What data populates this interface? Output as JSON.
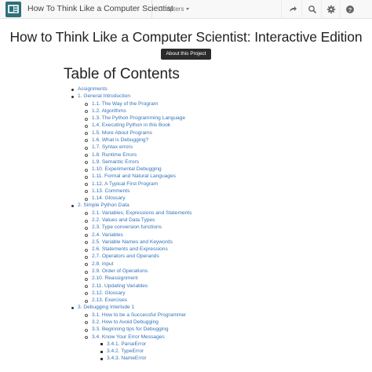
{
  "navbar": {
    "title": "How To Think Like a Computer Scientist",
    "chapters_label": "Chapters",
    "icons": [
      "forward-icon",
      "search-icon",
      "gear-icon",
      "help-icon"
    ]
  },
  "header": {
    "title": "How to Think Like a Computer Scientist: Interactive Edition",
    "about_button": "About this Project"
  },
  "toc": {
    "heading": "Table of Contents",
    "items": [
      {
        "level": 1,
        "label": "Assignments"
      },
      {
        "level": 1,
        "label": "1. General Introduction"
      },
      {
        "level": 2,
        "label": "1.1. The Way of the Program"
      },
      {
        "level": 2,
        "label": "1.2. Algorithms"
      },
      {
        "level": 2,
        "label": "1.3. The Python Programming Language"
      },
      {
        "level": 2,
        "label": "1.4. Executing Python in this Book"
      },
      {
        "level": 2,
        "label": "1.5. More About Programs"
      },
      {
        "level": 2,
        "label": "1.6. What is Debugging?"
      },
      {
        "level": 2,
        "label": "1.7. Syntax errors"
      },
      {
        "level": 2,
        "label": "1.8. Runtime Errors"
      },
      {
        "level": 2,
        "label": "1.9. Semantic Errors"
      },
      {
        "level": 2,
        "label": "1.10. Experimental Debugging"
      },
      {
        "level": 2,
        "label": "1.11. Formal and Natural Languages"
      },
      {
        "level": 2,
        "label": "1.12. A Typical First Program"
      },
      {
        "level": 2,
        "label": "1.13. Comments"
      },
      {
        "level": 2,
        "label": "1.14. Glossary"
      },
      {
        "level": 1,
        "label": "2. Simple Python Data"
      },
      {
        "level": 2,
        "label": "2.1. Variables, Expressions and Statements"
      },
      {
        "level": 2,
        "label": "2.2. Values and Data Types"
      },
      {
        "level": 2,
        "label": "2.3. Type conversion functions"
      },
      {
        "level": 2,
        "label": "2.4. Variables"
      },
      {
        "level": 2,
        "label": "2.5. Variable Names and Keywords"
      },
      {
        "level": 2,
        "label": "2.6. Statements and Expressions"
      },
      {
        "level": 2,
        "label": "2.7. Operators and Operands"
      },
      {
        "level": 2,
        "label": "2.8. Input"
      },
      {
        "level": 2,
        "label": "2.9. Order of Operations"
      },
      {
        "level": 2,
        "label": "2.10. Reassignment"
      },
      {
        "level": 2,
        "label": "2.11. Updating Variables"
      },
      {
        "level": 2,
        "label": "2.12. Glossary"
      },
      {
        "level": 2,
        "label": "2.13. Exercises"
      },
      {
        "level": 1,
        "label": "3. Debugging Interlude 1"
      },
      {
        "level": 2,
        "label": "3.1. How to be a Successful Programmer"
      },
      {
        "level": 2,
        "label": "3.2. How to Avoid Debugging"
      },
      {
        "level": 2,
        "label": "3.3. Beginning tips for Debugging"
      },
      {
        "level": 2,
        "label": "3.4. Know Your Error Messages"
      },
      {
        "level": 3,
        "label": "3.4.1. ParseError"
      },
      {
        "level": 3,
        "label": "3.4.2. TypeError"
      },
      {
        "level": 3,
        "label": "3.4.3. NameError"
      }
    ]
  },
  "colors": {
    "link": "#3674b7",
    "navbar_bg": "#f8f8f8",
    "button_bg": "#2b2b2b",
    "logo_bg": "#2f6f79"
  }
}
